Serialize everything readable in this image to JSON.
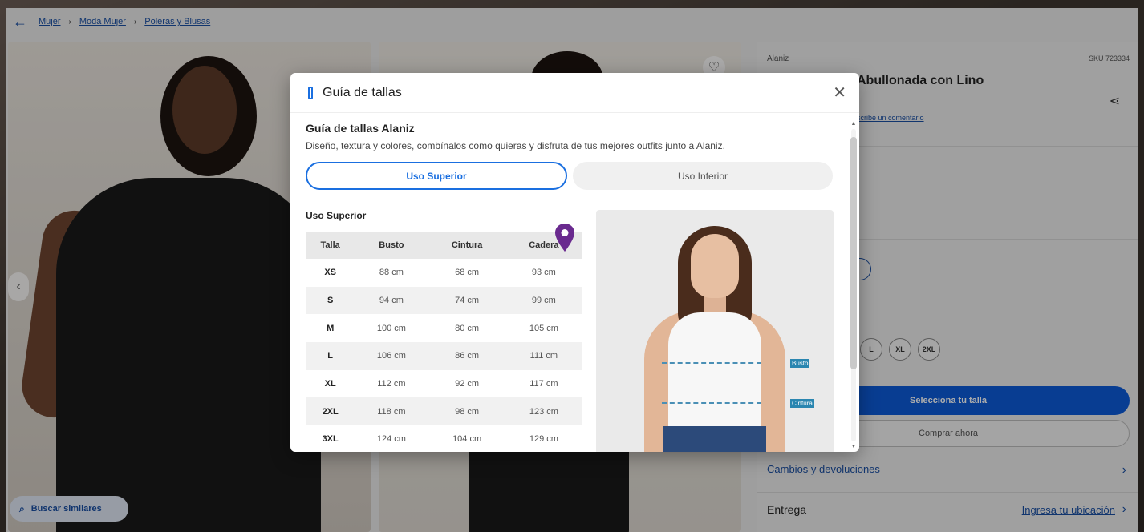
{
  "breadcrumb": {
    "items": [
      "Mujer",
      "Moda Mujer",
      "Poleras y Blusas"
    ]
  },
  "gallery": {
    "similar_label": "Buscar similares"
  },
  "product": {
    "brand": "Alaniz",
    "sku": "SKU 723334",
    "title_visible": "Abullonada con Lino",
    "review_link": "scribe un comentario",
    "sizes_visible": [
      "L",
      "XL",
      "2XL"
    ],
    "select_size_label": "Selecciona tu talla",
    "buy_now_label": "Comprar ahora",
    "returns_label": "Cambios y devoluciones",
    "delivery_label": "Entrega",
    "location_label": "Ingresa tu ubicación"
  },
  "modal": {
    "title": "Guía de tallas",
    "heading": "Guía de tallas Alaniz",
    "description": "Diseño, textura y colores, combínalos como quieras y disfruta de tus mejores outfits junto a Alaniz.",
    "tabs": [
      {
        "label": "Uso Superior",
        "active": true
      },
      {
        "label": "Uso Inferior",
        "active": false
      }
    ],
    "section_label": "Uso Superior",
    "table": {
      "headers": [
        "Talla",
        "Busto",
        "Cintura",
        "Cadera"
      ],
      "rows": [
        [
          "XS",
          "88 cm",
          "68 cm",
          "93 cm"
        ],
        [
          "S",
          "94 cm",
          "74 cm",
          "99 cm"
        ],
        [
          "M",
          "100 cm",
          "80 cm",
          "105 cm"
        ],
        [
          "L",
          "106 cm",
          "86 cm",
          "111 cm"
        ],
        [
          "XL",
          "112 cm",
          "92 cm",
          "117 cm"
        ],
        [
          "2XL",
          "118 cm",
          "98 cm",
          "123 cm"
        ],
        [
          "3XL",
          "124 cm",
          "104 cm",
          "129 cm"
        ]
      ]
    },
    "measure_tags": [
      "Busto",
      "Cintura"
    ]
  },
  "colors": {
    "accent": "#1a6fe0",
    "primary_button": "#0d5bd7",
    "pin": "#6a2a8f",
    "link": "#1a4fa3"
  },
  "icons": {
    "back": "arrow-left-icon",
    "close": "close-icon",
    "pin": "map-pin-icon",
    "heart": "heart-icon",
    "share": "share-icon",
    "search": "search-image-icon",
    "ruler": "ruler-icon"
  }
}
